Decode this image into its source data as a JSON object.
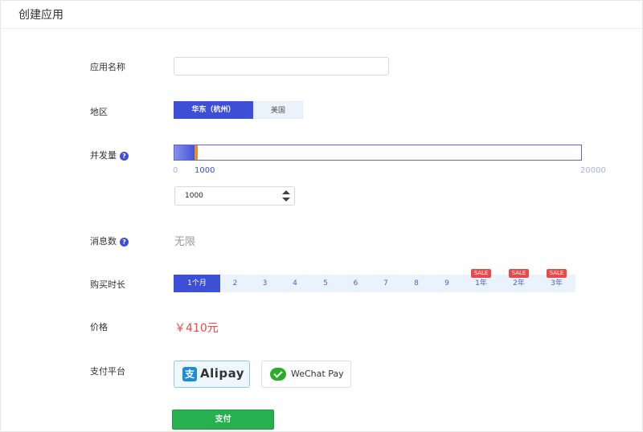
{
  "header": {
    "title": "创建应用"
  },
  "form": {
    "app_name": {
      "label": "应用名称",
      "value": ""
    },
    "region": {
      "label": "地区",
      "options": [
        "华东（杭州）",
        "美国"
      ],
      "selected": "华东（杭州）"
    },
    "concurrency": {
      "label": "并发量",
      "help": "?",
      "min": "0",
      "max": "20000",
      "current_label": "1000",
      "input_value": "1000",
      "value": 1000,
      "range": [
        0,
        20000
      ]
    },
    "messages": {
      "label": "消息数",
      "help": "?",
      "value": "无限"
    },
    "duration": {
      "label": "购买时长",
      "options": [
        "1个月",
        "2",
        "3",
        "4",
        "5",
        "6",
        "7",
        "8",
        "9",
        "1年",
        "2年",
        "3年"
      ],
      "selected": "1个月",
      "sale_badge": "SALE"
    },
    "price": {
      "label": "价格",
      "value": "￥410元"
    },
    "payment": {
      "label": "支付平台",
      "alipay": {
        "glyph": "支",
        "text": "Alipay"
      },
      "wechat": {
        "text": "WeChat Pay"
      },
      "selected": "Alipay"
    },
    "submit_label": "支付"
  },
  "colors": {
    "accent": "#3d4fd6",
    "price": "#f04848",
    "submit": "#26b04f",
    "slider_handle": "#f08a24",
    "sale": "#e84a4a"
  }
}
